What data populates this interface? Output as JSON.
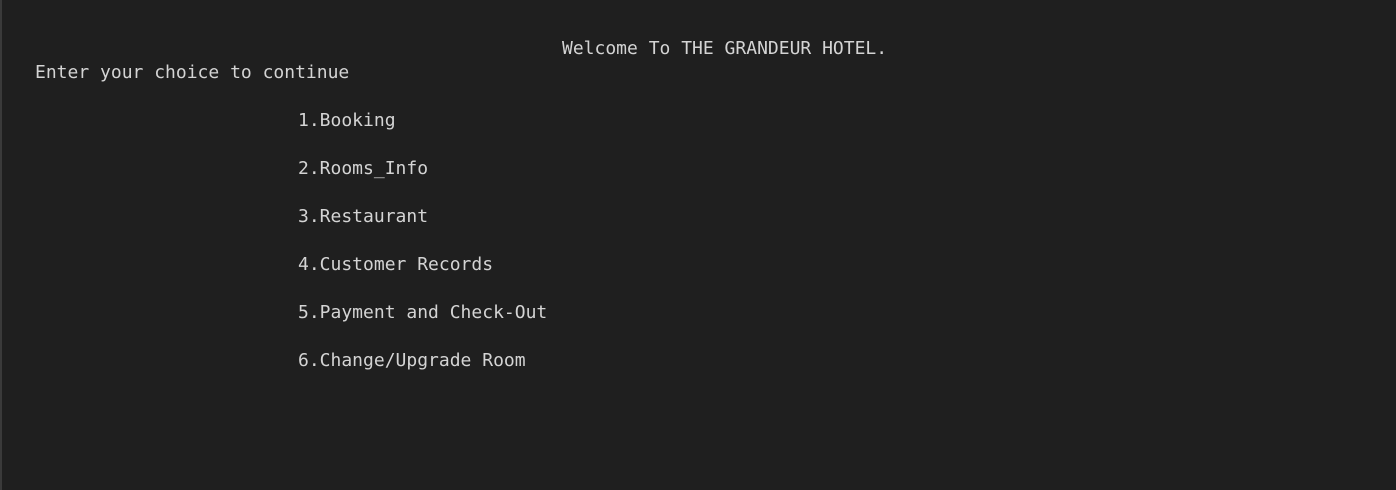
{
  "terminal": {
    "welcome_text": "Welcome To THE GRANDEUR HOTEL.",
    "prompt_text": "Enter your choice to continue",
    "menu": [
      {
        "label": "1.Booking"
      },
      {
        "label": "2.Rooms_Info"
      },
      {
        "label": "3.Restaurant"
      },
      {
        "label": "4.Customer Records"
      },
      {
        "label": "5.Payment and Check-Out"
      },
      {
        "label": "6.Change/Upgrade Room"
      }
    ],
    "colors": {
      "background": "#1f1f1f",
      "text": "#d4d4d4"
    }
  }
}
